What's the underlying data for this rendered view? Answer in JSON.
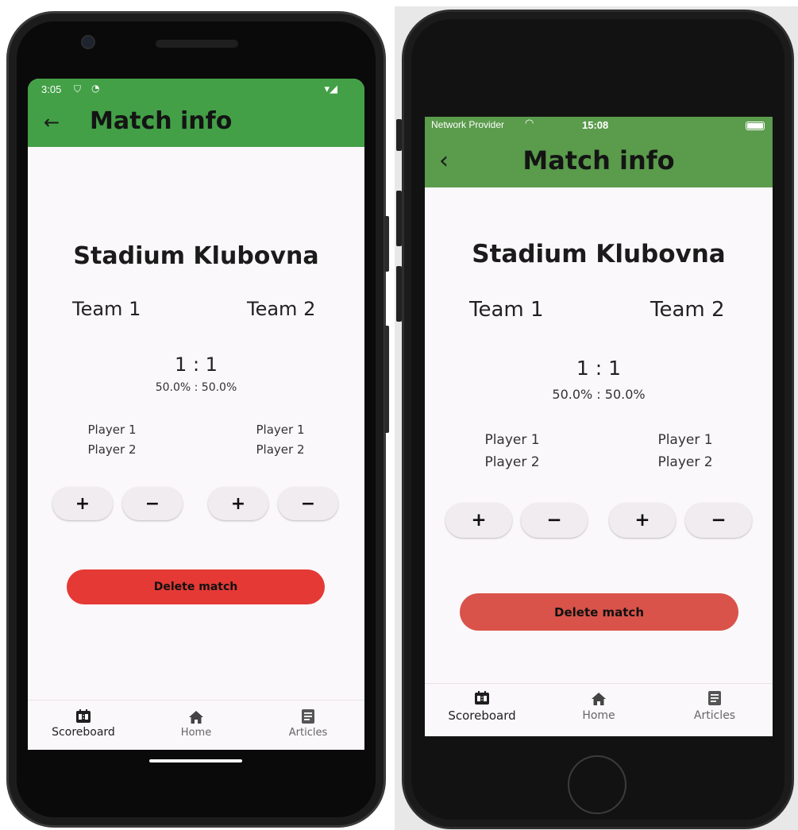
{
  "colors": {
    "android_app_bar": "#43a047",
    "ios_app_bar": "#5a9b4c",
    "screen_background": "#fbf8fb",
    "android_delete": "#e53935",
    "ios_delete": "#d9534a",
    "score_button_bg": "#f0ecf0"
  },
  "android": {
    "status": {
      "time": "3:05"
    },
    "app_bar": {
      "back_icon": "arrow-back-icon",
      "title": "Match info"
    },
    "stadium": "Stadium Klubovna",
    "team1": "Team 1",
    "team2": "Team 2",
    "score": "1 : 1",
    "percent": "50.0% : 50.0%",
    "team1_players": [
      "Player 1",
      "Player 2"
    ],
    "team2_players": [
      "Player 1",
      "Player 2"
    ],
    "buttons": {
      "plus": "+",
      "minus": "−"
    },
    "delete_label": "Delete match",
    "nav": [
      {
        "label": "Scoreboard",
        "icon": "scoreboard-icon"
      },
      {
        "label": "Home",
        "icon": "home-icon"
      },
      {
        "label": "Articles",
        "icon": "article-icon"
      }
    ]
  },
  "ios": {
    "status": {
      "carrier": "Network Provider",
      "time": "15:08"
    },
    "app_bar": {
      "back_icon": "chevron-left-icon",
      "title": "Match info"
    },
    "stadium": "Stadium Klubovna",
    "team1": "Team 1",
    "team2": "Team 2",
    "score": "1 : 1",
    "percent": "50.0% : 50.0%",
    "team1_players": [
      "Player 1",
      "Player 2"
    ],
    "team2_players": [
      "Player 1",
      "Player 2"
    ],
    "buttons": {
      "plus": "+",
      "minus": "−"
    },
    "delete_label": "Delete match",
    "nav": [
      {
        "label": "Scoreboard",
        "icon": "scoreboard-icon"
      },
      {
        "label": "Home",
        "icon": "home-icon"
      },
      {
        "label": "Articles",
        "icon": "article-icon"
      }
    ]
  }
}
